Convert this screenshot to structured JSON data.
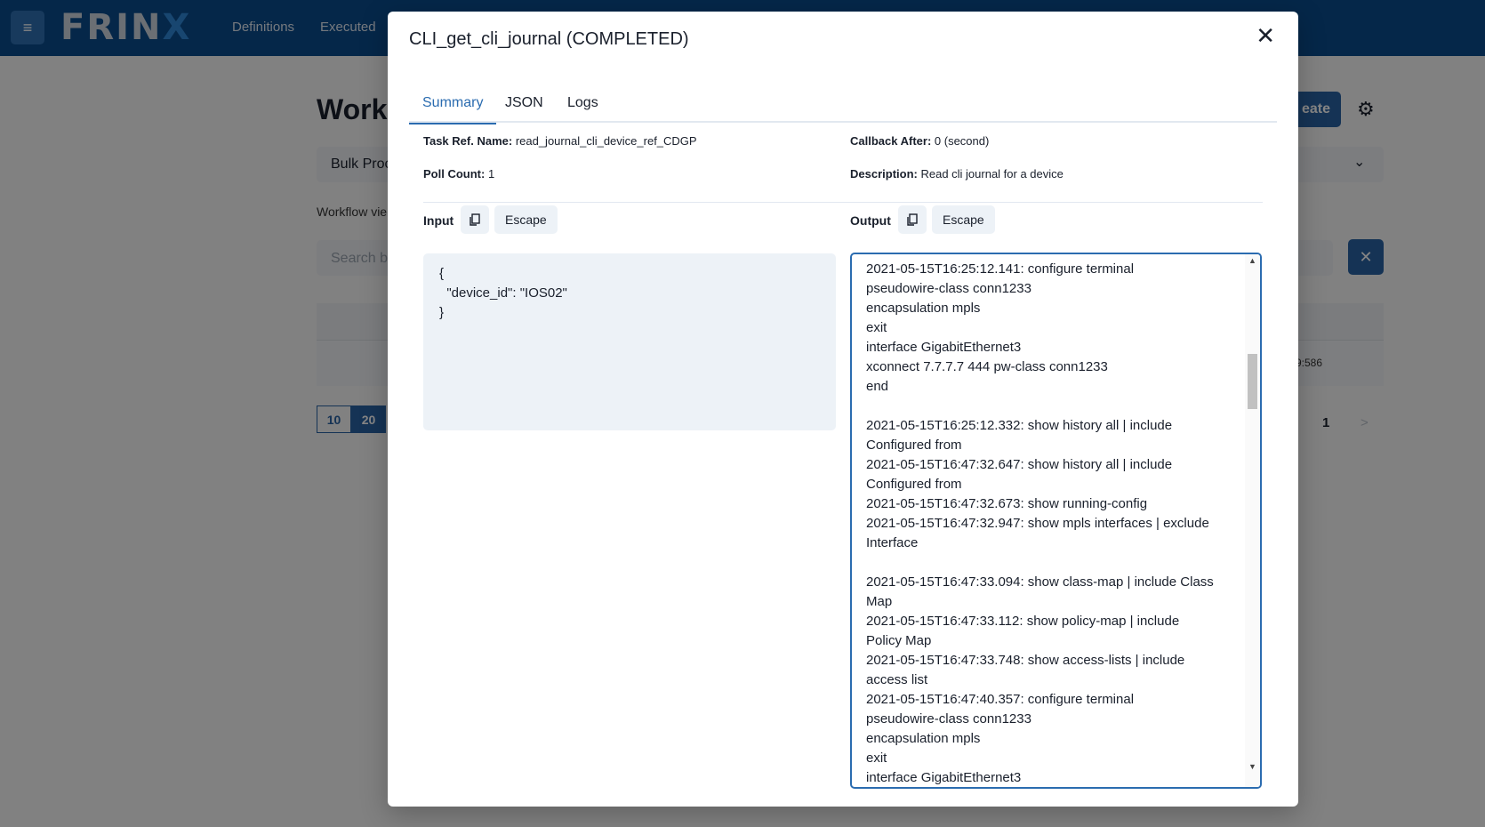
{
  "app": {
    "logo": "FRIN",
    "logo_x": "X",
    "menu_icon": "≡",
    "nav": [
      "Definitions",
      "Executed"
    ]
  },
  "background": {
    "title": "Work",
    "create_label": "eate",
    "select_label": "Bulk Proc",
    "hint": "Workflow vie",
    "search_placeholder": "Search by",
    "row_value": "9:586",
    "page_sizes": [
      "10",
      "20"
    ],
    "current_page": "1",
    "next_page": ">"
  },
  "modal": {
    "title": "CLI_get_cli_journal (COMPLETED)",
    "tabs": [
      "Summary",
      "JSON",
      "Logs"
    ],
    "active_tab": "Summary",
    "task_ref_label": "Task Ref. Name:",
    "task_ref_value": "read_journal_cli_device_ref_CDGP",
    "callback_label": "Callback After:",
    "callback_value": "0 (second)",
    "poll_label": "Poll Count:",
    "poll_value": "1",
    "description_label": "Description:",
    "description_value": "Read cli journal for a device",
    "input_label": "Input",
    "output_label": "Output",
    "escape_label": "Escape",
    "input_value": "{\n  \"device_id\": \"IOS02\"\n}",
    "output_value": "2021-05-15T16:25:12.141: configure terminal\npseudowire-class conn1233\nencapsulation mpls\nexit\ninterface GigabitEthernet3\nxconnect 7.7.7.7 444 pw-class conn1233\nend\n\n2021-05-15T16:25:12.332: show history all | include\nConfigured from\n2021-05-15T16:47:32.647: show history all | include\nConfigured from\n2021-05-15T16:47:32.673: show running-config\n2021-05-15T16:47:32.947: show mpls interfaces | exclude\nInterface\n\n2021-05-15T16:47:33.094: show class-map | include Class\nMap\n2021-05-15T16:47:33.112: show policy-map | include\nPolicy Map\n2021-05-15T16:47:33.748: show access-lists | include\naccess list\n2021-05-15T16:47:40.357: configure terminal\npseudowire-class conn1233\nencapsulation mpls\nexit\ninterface GigabitEthernet3"
  },
  "colors": {
    "navbar": "#0b4c8c",
    "accent": "#2b6cb0"
  }
}
